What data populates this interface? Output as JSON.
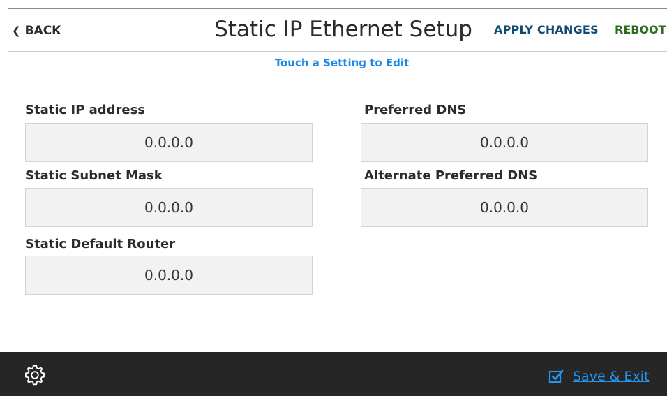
{
  "header": {
    "back_label": "BACK",
    "title": "Static IP Ethernet Setup",
    "apply_label": "APPLY CHANGES",
    "reboot_label": "REBOOT"
  },
  "hint": "Touch a Setting to Edit",
  "fields": {
    "static_ip": {
      "label": "Static IP address",
      "value": "0.0.0.0"
    },
    "subnet_mask": {
      "label": "Static Subnet Mask",
      "value": "0.0.0.0"
    },
    "default_router": {
      "label": "Static Default Router",
      "value": "0.0.0.0"
    },
    "preferred_dns": {
      "label": "Preferred DNS",
      "value": "0.0.0.0"
    },
    "alternate_dns": {
      "label": "Alternate Preferred DNS",
      "value": "0.0.0.0"
    }
  },
  "footer": {
    "settings_icon": "gear-icon",
    "save_exit_icon": "checkbox-checked-icon",
    "save_exit_label": "Save & Exit"
  },
  "colors": {
    "apply": "#0f4a73",
    "reboot": "#2f6b1f",
    "accent": "#1e88e5",
    "footer_bg": "#262626"
  }
}
